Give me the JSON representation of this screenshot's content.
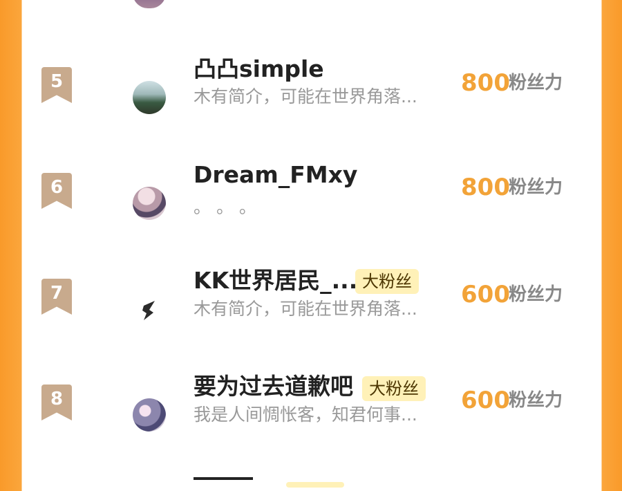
{
  "rows": [
    {
      "rank": "5",
      "name": "凸凸simple",
      "badge": "",
      "description": "木有简介，可能在世界角落...",
      "value": "800",
      "unit": "粉丝力"
    },
    {
      "rank": "6",
      "name": "Dream_FMxy",
      "badge": "",
      "description": "。 。 。",
      "value": "800",
      "unit": "粉丝力"
    },
    {
      "rank": "7",
      "name": "KK世界居民_...",
      "badge": "大粉丝",
      "description": "木有简介，可能在世界角落...",
      "value": "600",
      "unit": "粉丝力"
    },
    {
      "rank": "8",
      "name": "要为过去道歉吧",
      "badge": "大粉丝",
      "description": "我是人间惆怅客，知君何事...",
      "value": "600",
      "unit": "粉丝力"
    }
  ]
}
